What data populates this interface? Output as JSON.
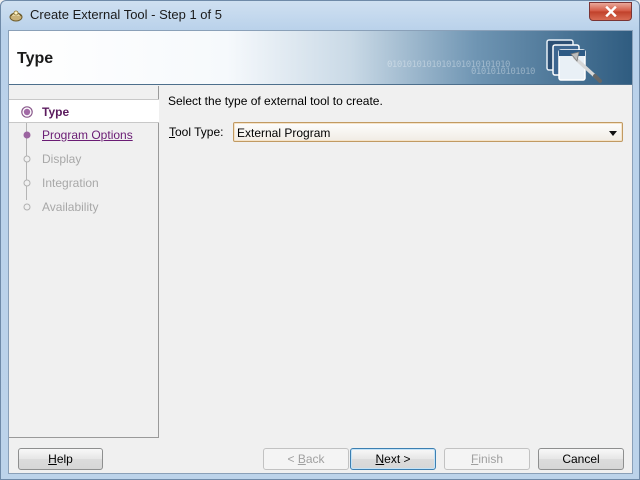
{
  "window": {
    "title": "Create External Tool - Step 1 of 5",
    "close_icon": "close-icon"
  },
  "header": {
    "title": "Type",
    "binary_1": "0101010101010101010101010",
    "binary_2": "0101010101010"
  },
  "steps": [
    {
      "label": "Type",
      "state": "current"
    },
    {
      "label": "Program Options",
      "state": "link"
    },
    {
      "label": "Display",
      "state": "disabled"
    },
    {
      "label": "Integration",
      "state": "disabled"
    },
    {
      "label": "Availability",
      "state": "disabled"
    }
  ],
  "main": {
    "instruction": "Select the type of external tool to create.",
    "tool_type_mnemonic": "T",
    "tool_type_rest": "ool Type:",
    "tool_type_value": "External Program"
  },
  "buttons": {
    "help": {
      "mnemonic": "H",
      "rest": "elp"
    },
    "back": {
      "prefix": "< ",
      "mnemonic": "B",
      "rest": "ack"
    },
    "next": {
      "mnemonic": "N",
      "rest": "ext >"
    },
    "finish": {
      "mnemonic": "F",
      "rest": "inish"
    },
    "cancel": {
      "label": "Cancel"
    }
  },
  "colors": {
    "current_step": "#5b1b5e",
    "link_step": "#6a1c74",
    "disabled": "#a8a8a8",
    "select_border": "#c19a62"
  }
}
